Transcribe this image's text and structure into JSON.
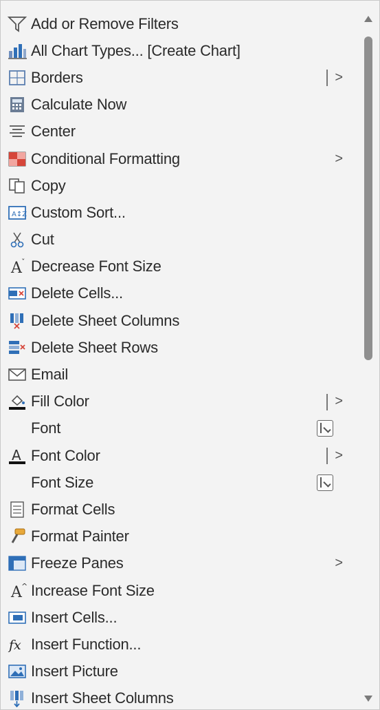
{
  "menu": {
    "items": [
      {
        "label": "Add or Remove Filters",
        "icon": "filter-icon",
        "arrow": ""
      },
      {
        "label": "All Chart Types... [Create Chart]",
        "icon": "chart-icon",
        "arrow": ""
      },
      {
        "label": "Borders",
        "icon": "borders-icon",
        "arrow": ">"
      },
      {
        "label": "Calculate Now",
        "icon": "calculator-icon",
        "arrow": ""
      },
      {
        "label": "Center",
        "icon": "align-center-icon",
        "arrow": ""
      },
      {
        "label": "Conditional Formatting",
        "icon": "conditional-formatting-icon",
        "arrow": ">"
      },
      {
        "label": "Copy",
        "icon": "copy-icon",
        "arrow": ""
      },
      {
        "label": "Custom Sort...",
        "icon": "sort-icon",
        "arrow": ""
      },
      {
        "label": "Cut",
        "icon": "scissors-icon",
        "arrow": ""
      },
      {
        "label": "Decrease Font Size",
        "icon": "decrease-font-icon",
        "arrow": ""
      },
      {
        "label": "Delete Cells...",
        "icon": "delete-cells-icon",
        "arrow": ""
      },
      {
        "label": "Delete Sheet Columns",
        "icon": "delete-columns-icon",
        "arrow": ""
      },
      {
        "label": "Delete Sheet Rows",
        "icon": "delete-rows-icon",
        "arrow": ""
      },
      {
        "label": "Email",
        "icon": "email-icon",
        "arrow": ""
      },
      {
        "label": "Fill Color",
        "icon": "fill-color-icon",
        "arrow": ">"
      },
      {
        "label": "Font",
        "icon": "",
        "arrow": ""
      },
      {
        "label": "Font Color",
        "icon": "font-color-icon",
        "arrow": ">"
      },
      {
        "label": "Font Size",
        "icon": "",
        "arrow": ""
      },
      {
        "label": "Format Cells",
        "icon": "format-cells-icon",
        "arrow": ""
      },
      {
        "label": "Format Painter",
        "icon": "format-painter-icon",
        "arrow": ""
      },
      {
        "label": "Freeze Panes",
        "icon": "freeze-panes-icon",
        "arrow": ">"
      },
      {
        "label": "Increase Font Size",
        "icon": "increase-font-icon",
        "arrow": ""
      },
      {
        "label": "Insert Cells...",
        "icon": "insert-cells-icon",
        "arrow": ""
      },
      {
        "label": "Insert Function...",
        "icon": "function-icon",
        "arrow": ""
      },
      {
        "label": "Insert Picture",
        "icon": "picture-icon",
        "arrow": ""
      },
      {
        "label": "Insert Sheet Columns",
        "icon": "insert-columns-icon",
        "arrow": ""
      }
    ]
  },
  "colors": {
    "background": "#f3f3f3",
    "accent": "#2f6fb7",
    "text": "#2a2a2a"
  }
}
